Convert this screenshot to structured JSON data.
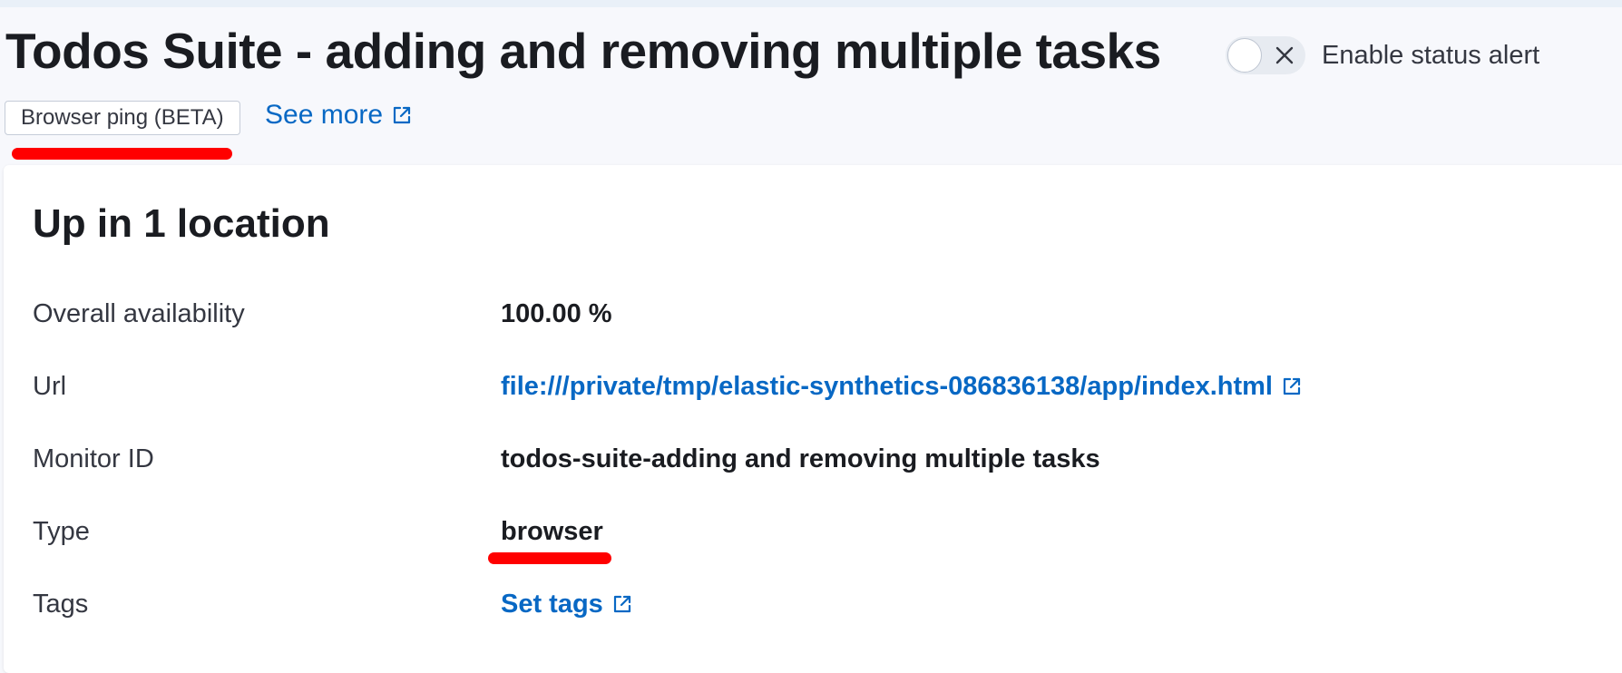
{
  "header": {
    "title": "Todos Suite - adding and removing multiple tasks",
    "status_alert_toggle": {
      "label": "Enable status alert",
      "checked": false,
      "icon": "close-icon"
    },
    "monitor_type_badge": "Browser ping (BETA)",
    "see_more_link": {
      "label": "See more",
      "icon": "external-link-icon"
    }
  },
  "summary_card": {
    "title": "Up in 1 location",
    "rows": [
      {
        "label": "Overall availability",
        "value": "100.00 %"
      },
      {
        "label": "Url",
        "value": "file:///private/tmp/elastic-synthetics-086836138/app/index.html",
        "icon": "external-link-icon"
      },
      {
        "label": "Monitor ID",
        "value": "todos-suite-adding and removing multiple tasks"
      },
      {
        "label": "Type",
        "value": "browser"
      },
      {
        "label": "Tags",
        "value": "Set tags",
        "icon": "external-link-icon"
      }
    ]
  },
  "colors": {
    "link": "#0868c4",
    "annotation": "#ff0000",
    "page_background": "#f7f8fc",
    "card_background": "#ffffff",
    "text": "#1a1c21"
  }
}
